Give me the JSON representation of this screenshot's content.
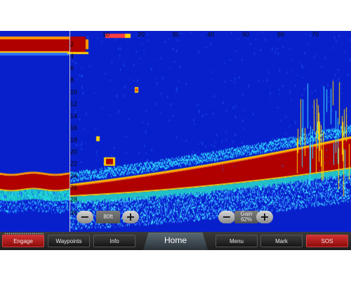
{
  "depth_axis": {
    "labels": [
      "2",
      "4",
      "6",
      "8",
      "10",
      "12",
      "14",
      "16",
      "18",
      "20",
      "22",
      "24",
      "26",
      "28",
      "30"
    ]
  },
  "top_axis": {
    "labels": [
      "10",
      "20",
      "30",
      "40",
      "50",
      "60",
      "70"
    ]
  },
  "range_control": {
    "minus": "−",
    "value": "80ft",
    "plus": "+"
  },
  "gain_control": {
    "minus": "−",
    "label": "Gain",
    "value": "62%",
    "plus": "+"
  },
  "softkeys": {
    "engage": "Engage",
    "waypoints": "Waypoints",
    "info": "Info",
    "home": "Home",
    "menu": "Menu",
    "mark": "Mark",
    "sos": "SOS"
  },
  "colors": {
    "water": "#0820cc",
    "strong_return": "#b00000",
    "accent_red": "#c81e1e"
  }
}
